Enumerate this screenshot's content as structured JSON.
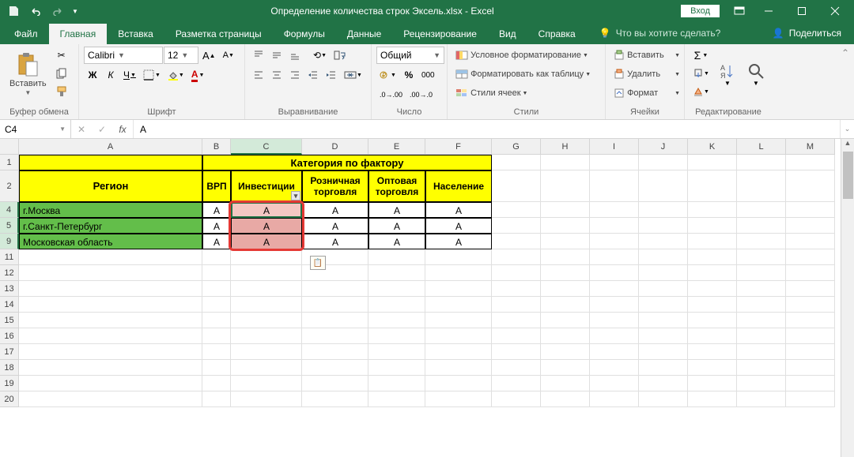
{
  "title": "Определение количества строк Эксель.xlsx  -  Excel",
  "login": "Вход",
  "tabs": {
    "file": "Файл",
    "items": [
      "Главная",
      "Вставка",
      "Разметка страницы",
      "Формулы",
      "Данные",
      "Рецензирование",
      "Вид",
      "Справка"
    ],
    "active": 0,
    "tell_me": "Что вы хотите сделать?",
    "share": "Поделиться"
  },
  "ribbon": {
    "clipboard": {
      "paste": "Вставить",
      "label": "Буфер обмена"
    },
    "font": {
      "name": "Calibri",
      "size": "12",
      "bold": "Ж",
      "italic": "К",
      "underline": "Ч",
      "label": "Шрифт"
    },
    "alignment": {
      "label": "Выравнивание"
    },
    "number": {
      "format": "Общий",
      "label": "Число"
    },
    "styles": {
      "cond": "Условное форматирование",
      "table": "Форматировать как таблицу",
      "cell": "Стили ячеек",
      "label": "Стили"
    },
    "cells": {
      "insert": "Вставить",
      "delete": "Удалить",
      "format": "Формат",
      "label": "Ячейки"
    },
    "editing": {
      "label": "Редактирование"
    }
  },
  "namebox": "C4",
  "formula": "A",
  "columns": [
    "A",
    "B",
    "C",
    "D",
    "E",
    "F",
    "G",
    "H",
    "I",
    "J",
    "K",
    "L",
    "M"
  ],
  "row_numbers": [
    "1",
    "2",
    "4",
    "5",
    "9",
    "11",
    "12",
    "13",
    "14",
    "15",
    "16",
    "17",
    "18",
    "19",
    "20"
  ],
  "table": {
    "header_top": "Категория по фактору",
    "region": "Регион",
    "cols": [
      "ВРП",
      "Инвестиции",
      "Розничная торговля",
      "Оптовая торговля",
      "Население"
    ],
    "rows": [
      {
        "region": "г.Москва",
        "v": [
          "A",
          "A",
          "A",
          "A",
          "A"
        ]
      },
      {
        "region": "г.Санкт-Петербург",
        "v": [
          "A",
          "A",
          "A",
          "A",
          "A"
        ]
      },
      {
        "region": "Московская область",
        "v": [
          "A",
          "A",
          "A",
          "A",
          "A"
        ]
      }
    ]
  }
}
